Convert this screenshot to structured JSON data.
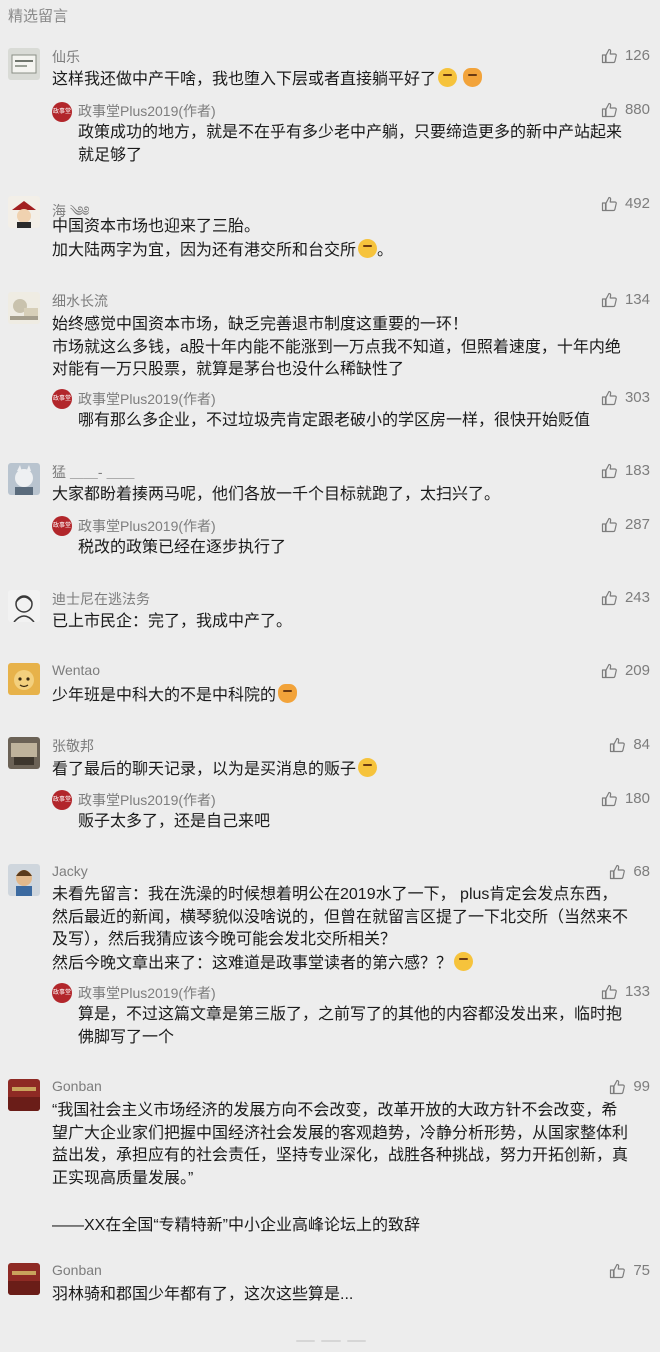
{
  "section_title": "精选留言",
  "comments": [
    {
      "name": "仙乐",
      "likes": "126",
      "text": [
        "这样我还做中产干啥，我也堕入下层或者直接躺平好了"
      ],
      "emoji_icons": [
        "sunglasses-emoji-icon",
        "cat-emoji-icon"
      ],
      "reply": {
        "name": "政事堂Plus2019(作者)",
        "likes": "880",
        "text": [
          "政策成功的地方，就是不在乎有多少老中产躺，只要缔造更多的新中产站起来",
          "就足够了"
        ]
      }
    },
    {
      "name": "海 ༄༅",
      "likes": "492",
      "text": [
        "中国资本市场也迎来了三胎。",
        "加大陆两字为宜，因为还有港交所和台交所"
      ],
      "emoji_icons": [
        "smirk-emoji-icon"
      ]
    },
    {
      "name": "细水长流",
      "likes": "134",
      "text": [
        "始终感觉中国资本市场，缺乏完善退市制度这重要的一环！",
        "市场就这么多钱，a股十年内能不能涨到一万点我不知道，但照着速度，十年内绝",
        "对能有一万只股票，就算是茅台也没什么稀缺性了"
      ],
      "reply": {
        "name": "政事堂Plus2019(作者)",
        "likes": "303",
        "text": [
          "哪有那么多企业，不过垃圾壳肯定跟老破小的学区房一样，很快开始贬值"
        ]
      }
    },
    {
      "name": "猛 ＿＿- ＿＿",
      "likes": "183",
      "text": [
        "大家都盼着揍两马呢，他们各放一千个目标就跑了，太扫兴了。"
      ],
      "reply": {
        "name": "政事堂Plus2019(作者)",
        "likes": "287",
        "text": [
          "税改的政策已经在逐步执行了"
        ]
      }
    },
    {
      "name": "迪士尼在逃法务",
      "likes": "243",
      "text": [
        "已上市民企：完了，我成中产了。"
      ]
    },
    {
      "name": "Wentao",
      "likes": "209",
      "text": [
        "少年班是中科大的不是中科院的"
      ],
      "emoji_icons": [
        "cat-emoji-icon"
      ]
    },
    {
      "name": "张敬邦",
      "likes": "84",
      "text": [
        "看了最后的聊天记录，以为是买消息的贩子"
      ],
      "emoji_icons": [
        "flushed-emoji-icon"
      ],
      "reply": {
        "name": "政事堂Plus2019(作者)",
        "likes": "180",
        "text": [
          "贩子太多了，还是自己来吧"
        ]
      }
    },
    {
      "name": "Jacky",
      "likes": "68",
      "text": [
        "未看先留言：我在洗澡的时候想着明公在2019水了一下，  plus肯定会发点东西，",
        "然后最近的新闻，横琴貌似没啥说的，但曾在就留言区提了一下北交所（当然来不",
        "及写），然后我猜应该今晚可能会发北交所相关？",
        "然后今晚文章出来了：这难道是政事堂读者的第六感？？"
      ],
      "emoji_icons": [
        "laugh-cry-emoji-icon"
      ],
      "reply": {
        "name": "政事堂Plus2019(作者)",
        "likes": "133",
        "text": [
          "算是，不过这篇文章是第三版了，之前写了的其他的内容都没发出来，临时抱",
          "佛脚写了一个"
        ]
      }
    },
    {
      "name": "Gonban",
      "likes": "99",
      "text": [
        "“我国社会主义市场经济的发展方向不会改变，改革开放的大政方针不会改变，希",
        "望广大企业家们把握中国经济社会发展的客观趋势，冷静分析形势，从国家整体利",
        "益出发，承担应有的社会责任，坚持专业深化，战胜各种挑战，努力开拓创新，真",
        "正实现高质量发展。”"
      ],
      "signature": "——XX在全国“专精特新”中小企业高峰论坛上的致辞"
    },
    {
      "name": "Gonban",
      "likes": "75",
      "text": [
        "羽林骑和郡国少年都有了，这次这些算是..."
      ]
    }
  ],
  "colors": {
    "background": "#ededed",
    "meta_text": "#7d7d7d",
    "body_text": "#1a1a1a",
    "author_badge": "#b2262b"
  }
}
